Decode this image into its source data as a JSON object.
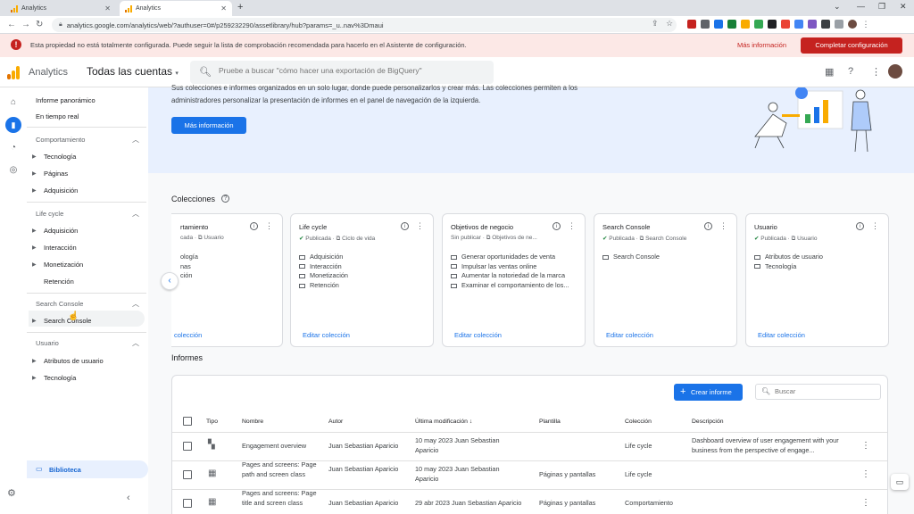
{
  "browser": {
    "tabs": [
      {
        "label": "Analytics",
        "active": false
      },
      {
        "label": "Analytics",
        "active": true
      }
    ],
    "url": "analytics.google.com/analytics/web/?authuser=0#/p259232290/assetlibrary/hub?params=_u..nav%3Dmaui"
  },
  "banner": {
    "message": "Esta propiedad no está totalmente configurada. Puede seguir la lista de comprobación recomendada para hacerlo en el Asistente de configuración.",
    "more_link": "Más información",
    "cta": "Completar configuración"
  },
  "header": {
    "product": "Analytics",
    "account": "Todas las cuentas",
    "search_placeholder": "Pruebe a buscar \"cómo hacer una exportación de BigQuery\""
  },
  "nav": {
    "top_items": [
      "Informe panorámico",
      "En tiempo real"
    ],
    "sections": [
      {
        "title": "Comportamiento",
        "items": [
          {
            "label": "Tecnología",
            "expandable": true
          },
          {
            "label": "Páginas",
            "expandable": true
          },
          {
            "label": "Adquisición",
            "expandable": true
          }
        ]
      },
      {
        "title": "Life cycle",
        "items": [
          {
            "label": "Adquisición",
            "expandable": true
          },
          {
            "label": "Interacción",
            "expandable": true
          },
          {
            "label": "Monetización",
            "expandable": true
          },
          {
            "label": "Retención",
            "expandable": false
          }
        ]
      },
      {
        "title": "Search Console",
        "items": [
          {
            "label": "Search Console",
            "expandable": true
          }
        ]
      },
      {
        "title": "Usuario",
        "items": [
          {
            "label": "Atributos de usuario",
            "expandable": true
          },
          {
            "label": "Tecnología",
            "expandable": true
          }
        ]
      }
    ],
    "library": "Biblioteca"
  },
  "hero": {
    "line1": "Sus colecciones e informes organizados en un solo lugar, donde puede personalizarlos y crear más. Las colecciones permiten a los",
    "line2": "administradores personalizar la presentación de informes en el panel de navegación de la izquierda.",
    "button": "Más información"
  },
  "collections": {
    "title": "Colecciones",
    "cards": [
      {
        "title": "rtamiento",
        "status": "cada",
        "template": "Usuario",
        "items": [
          "ología",
          "nas",
          "ción"
        ],
        "edit": "colección"
      },
      {
        "title": "Life cycle",
        "status": "Publicada",
        "template": "Ciclo de vida",
        "items": [
          "Adquisición",
          "Interacción",
          "Monetización",
          "Retención"
        ],
        "edit": "Editar colección"
      },
      {
        "title": "Objetivos de negocio",
        "status": "Sin publicar",
        "template": "Objetivos de ne...",
        "items": [
          "Generar oportunidades de venta",
          "Impulsar las ventas online",
          "Aumentar la notoriedad de la marca",
          "Examinar el comportamiento de los..."
        ],
        "edit": "Editar colección"
      },
      {
        "title": "Search Console",
        "status": "Publicada",
        "template": "Search Console",
        "items": [
          "Search Console"
        ],
        "edit": "Editar colección"
      },
      {
        "title": "Usuario",
        "status": "Publicada",
        "template": "Usuario",
        "items": [
          "Atributos de usuario",
          "Tecnología"
        ],
        "edit": "Editar colección"
      }
    ]
  },
  "reports": {
    "title": "Informes",
    "create_button": "Crear informe",
    "search_placeholder": "Buscar",
    "columns": [
      "Tipo",
      "Nombre",
      "Autor",
      "Última modificación",
      "Plantilla",
      "Colección",
      "Descripción"
    ],
    "rows": [
      {
        "type_icon": "dashboard-icon",
        "name": "Engagement overview",
        "author": "Juan Sebastian Aparicio",
        "modified": "10 may 2023 Juan Sebastian Aparicio",
        "template": "",
        "collection": "Life cycle",
        "description": "Dashboard overview of user engagement with your business from the perspective of engage..."
      },
      {
        "type_icon": "table-icon",
        "name": "Pages and screens: Page path and screen class",
        "author": "Juan Sebastian Aparicio",
        "modified": "10 may 2023 Juan Sebastian Aparicio",
        "template": "Páginas y pantallas",
        "collection": "Life cycle",
        "description": ""
      },
      {
        "type_icon": "table-icon",
        "name": "Pages and screens: Page title and screen class",
        "author": "Juan Sebastian Aparicio",
        "modified": "29 abr 2023 Juan Sebastian Aparicio",
        "template": "Páginas y pantallas",
        "collection": "Comportamiento",
        "description": ""
      }
    ]
  },
  "colors": {
    "accent": "#1a73e8",
    "danger": "#c5221f",
    "banner_bg": "#fce8e6",
    "hero_bg": "#e8f0fe",
    "success": "#188038"
  }
}
